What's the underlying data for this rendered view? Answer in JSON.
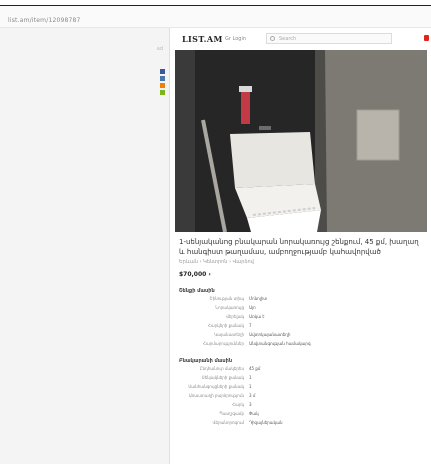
{
  "browser": {
    "url": "list.am/item/12098787"
  },
  "header": {
    "logo": "LIST.AM",
    "nav_link": "Gr Login",
    "search_placeholder": "Search"
  },
  "sidebar": {
    "ad_label": "ad"
  },
  "share_icons": [
    {
      "icon": "facebook-icon",
      "color": "#3b5998"
    },
    {
      "icon": "vk-icon",
      "color": "#4a76a8"
    },
    {
      "icon": "ok-icon",
      "color": "#ee8208"
    },
    {
      "icon": "viber-icon",
      "color": "#7bb51b"
    }
  ],
  "listing": {
    "title": "1-սենյականոց բնակարան նորակառույց շենքում, 45 քմ, խաղաղ և հանգիստ թաղամաս, ամբողջությամբ կահավորված",
    "subinfo": "Երևան › Կենտրոն › Վարձով",
    "price": "$70,000 ›",
    "sections": [
      {
        "title": "Շենքի մասին",
        "rows": [
          {
            "key": "Շինության տիպ",
            "value": "Մոնոլիտ"
          },
          {
            "key": "Նորակառույց",
            "value": "Այո"
          },
          {
            "key": "Վերելակ",
            "value": "Առկա է"
          },
          {
            "key": "Հարկերի քանակ",
            "value": "7"
          },
          {
            "key": "Կայանատեղի",
            "value": "Ավտոկայանատեղի"
          },
          {
            "key": "Հարմարություններ",
            "value": "Անվտանգության համակարգ"
          }
        ]
      },
      {
        "title": "Բնակարանի մասին",
        "rows": [
          {
            "key": "Ընդհանուր մակերես",
            "value": "45 քմ"
          },
          {
            "key": "Սենյակների քանակ",
            "value": "1"
          },
          {
            "key": "Սանհանգույցների քանակ",
            "value": "1"
          },
          {
            "key": "Առաստաղի բարձրություն",
            "value": "3 մ"
          },
          {
            "key": "Հարկ",
            "value": "3"
          },
          {
            "key": "Պատշգամբ",
            "value": "Փակ"
          },
          {
            "key": "Վերանորոգում",
            "value": "Դիզայներական"
          }
        ]
      }
    ]
  }
}
